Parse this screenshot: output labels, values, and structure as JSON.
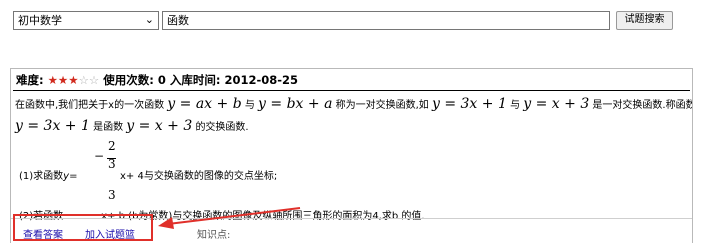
{
  "search": {
    "category_value": "初中数学",
    "keyword_value": "函数",
    "button_label": "试题搜索"
  },
  "question": {
    "difficulty_label": "难度:",
    "stars_filled": "★★★",
    "stars_empty": "☆☆",
    "difficulty_level": 3,
    "usage_label": "使用次数:",
    "usage_count": "0",
    "date_label": "入库时间:",
    "date_value": "2012-08-25",
    "line1_a": "在函数中,我们把关于x的一次函数",
    "line1_m1": "y = ax + b",
    "line1_b": "与",
    "line1_m2": "y = bx + a",
    "line1_c": "称为一对交换函数,如",
    "line1_m3": "y = 3x + 1",
    "line1_d": "与",
    "line1_m4": "y = x + 3",
    "line1_e": "是一对交换函数.称函数",
    "line2_m1": "y = 3x + 1",
    "line2_a": "是函数",
    "line2_m2": "y = x + 3",
    "line2_b": "的交换函数.",
    "part1_a": "(1)求函数",
    "part1_y": "y",
    "part1_eq": "=",
    "frac_minus": "−",
    "frac_num": "2",
    "frac_den": "3",
    "part1_b": "x+ 4与交换函数的图像的交点坐标;",
    "part2_a": "(2)若函数",
    "part2_b": "x+ b (b为常数)与交换函数的图像及纵轴所围三角形的面积为4,求b 的值."
  },
  "footer": {
    "view_answer": "查看答案",
    "add_to_basket": "加入试题篮",
    "knowledge_label": "知识点:"
  },
  "colors": {
    "star_filled": "#d12a1e",
    "link": "#1a0dab",
    "highlight": "#e0302a"
  }
}
